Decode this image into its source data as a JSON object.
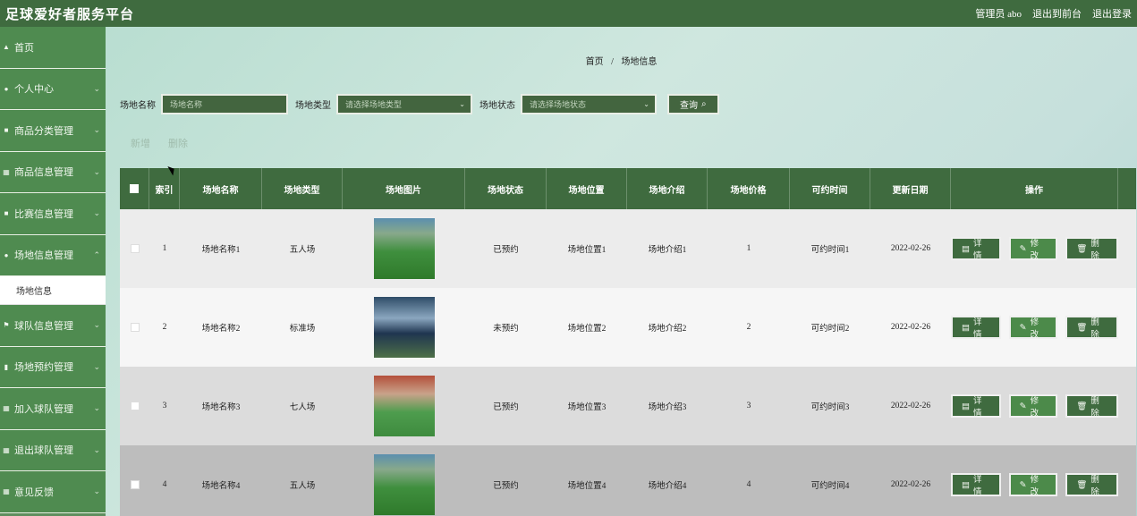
{
  "app": {
    "title": "足球爱好者服务平台"
  },
  "topbar": {
    "admin": "管理员 abo",
    "front": "退出到前台",
    "logout": "退出登录"
  },
  "sidebar": {
    "items": [
      {
        "label": "首页",
        "icon": "home-icon"
      },
      {
        "label": "个人中心",
        "icon": "user-icon"
      },
      {
        "label": "商品分类管理",
        "icon": "folder-icon"
      },
      {
        "label": "商品信息管理",
        "icon": "grid-icon"
      },
      {
        "label": "比赛信息管理",
        "icon": "folder-icon"
      },
      {
        "label": "场地信息管理",
        "icon": "user-icon"
      },
      {
        "label": "球队信息管理",
        "icon": "flag-icon"
      },
      {
        "label": "场地预约管理",
        "icon": "chart-icon"
      },
      {
        "label": "加入球队管理",
        "icon": "grid-icon"
      },
      {
        "label": "退出球队管理",
        "icon": "grid-icon"
      },
      {
        "label": "意见反馈",
        "icon": "grid-icon"
      }
    ],
    "sub_label": "场地信息"
  },
  "breadcrumb": {
    "home": "首页",
    "sep": "/",
    "current": "场地信息"
  },
  "search": {
    "name_label": "场地名称",
    "name_placeholder": "场地名称",
    "type_label": "场地类型",
    "type_placeholder": "请选择场地类型",
    "status_label": "场地状态",
    "status_placeholder": "请选择场地状态",
    "query_label": "查询",
    "query_icon": "search-icon"
  },
  "actions": {
    "add": "新增",
    "delete": "删除"
  },
  "table": {
    "headers": [
      "索引",
      "场地名称",
      "场地类型",
      "场地图片",
      "场地状态",
      "场地位置",
      "场地介绍",
      "场地价格",
      "可约时间",
      "更新日期",
      "操作"
    ],
    "rows": [
      {
        "index": "1",
        "name": "场地名称1",
        "type": "五人场",
        "status": "已预约",
        "location": "场地位置1",
        "intro": "场地介绍1",
        "price": "1",
        "time": "可约时间1",
        "date": "2022-02-26"
      },
      {
        "index": "2",
        "name": "场地名称2",
        "type": "标准场",
        "status": "未预约",
        "location": "场地位置2",
        "intro": "场地介绍2",
        "price": "2",
        "time": "可约时间2",
        "date": "2022-02-26"
      },
      {
        "index": "3",
        "name": "场地名称3",
        "type": "七人场",
        "status": "已预约",
        "location": "场地位置3",
        "intro": "场地介绍3",
        "price": "3",
        "time": "可约时间3",
        "date": "2022-02-26"
      },
      {
        "index": "4",
        "name": "场地名称4",
        "type": "五人场",
        "status": "已预约",
        "location": "场地位置4",
        "intro": "场地介绍4",
        "price": "4",
        "time": "可约时间4",
        "date": "2022-02-26"
      }
    ],
    "op_detail": "详情",
    "op_edit": "修改",
    "op_delete": "删除"
  },
  "colors": {
    "primary": "#3f6b3f",
    "sidebar": "#4f8b50"
  }
}
